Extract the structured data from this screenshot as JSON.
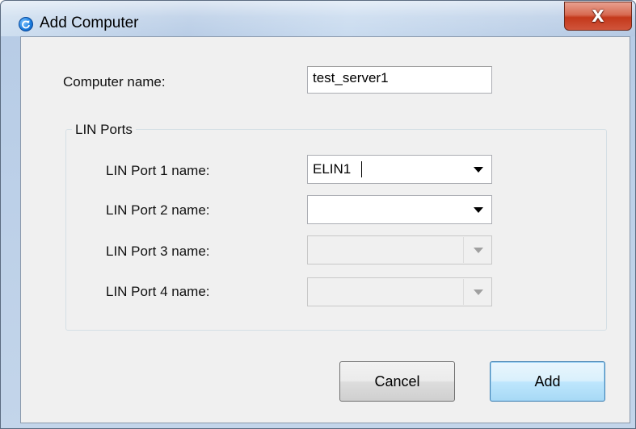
{
  "window": {
    "title": "Add Computer",
    "close_label": "X"
  },
  "form": {
    "computer_name_label": "Computer name:",
    "computer_name_value": "test_server1",
    "group_title": "LIN Ports",
    "ports": [
      {
        "label": "LIN Port 1 name:",
        "value": "ELIN1",
        "enabled": true
      },
      {
        "label": "LIN Port 2 name:",
        "value": "",
        "enabled": true
      },
      {
        "label": "LIN Port 3 name:",
        "value": "",
        "enabled": false
      },
      {
        "label": "LIN Port 4 name:",
        "value": "",
        "enabled": false
      }
    ]
  },
  "buttons": {
    "cancel_label": "Cancel",
    "add_label": "Add"
  },
  "icons": {
    "app": "refresh-circle-icon",
    "close": "close-icon",
    "dropdown": "chevron-down-icon"
  }
}
